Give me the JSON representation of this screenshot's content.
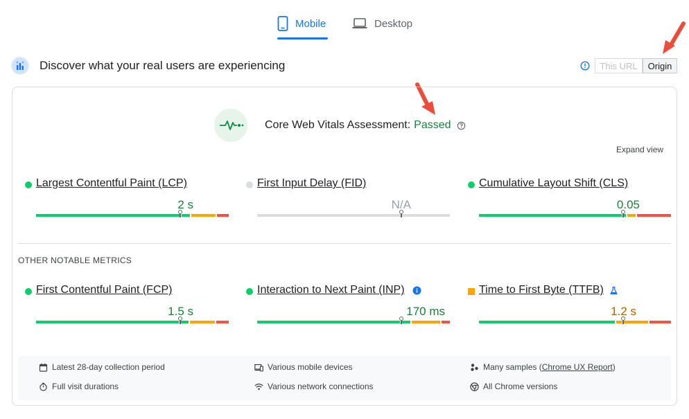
{
  "tabs": [
    {
      "label": "Mobile",
      "active": true
    },
    {
      "label": "Desktop",
      "active": false
    }
  ],
  "header": {
    "title": "Discover what your real users are experiencing",
    "scope_this_url": "This URL",
    "scope_origin": "Origin",
    "selected_scope": "Origin"
  },
  "assessment": {
    "label": "Core Web Vitals Assessment:",
    "status": "Passed",
    "expand_label": "Expand view"
  },
  "core_metrics": [
    {
      "name": "Largest Contentful Paint (LCP)",
      "value": "2 s",
      "status": "good",
      "marker": 0.75,
      "color": "#188038"
    },
    {
      "name": "First Input Delay (FID)",
      "value": "N/A",
      "status": "none",
      "marker": 0.75,
      "color": "#9aa0a6"
    },
    {
      "name": "Cumulative Layout Shift (CLS)",
      "value": "0.05",
      "status": "good",
      "marker": 0.75,
      "color": "#188038"
    }
  ],
  "other_title": "OTHER NOTABLE METRICS",
  "other_metrics": [
    {
      "name": "First Contentful Paint (FCP)",
      "value": "1.5 s",
      "status": "good",
      "marker": 0.75,
      "color": "#188038"
    },
    {
      "name": "Interaction to Next Paint (INP)",
      "value": "170 ms",
      "status": "good",
      "marker": 0.75,
      "color": "#188038"
    },
    {
      "name": "Time to First Byte (TTFB)",
      "value": "1.2 s",
      "status": "average",
      "marker": 0.75,
      "color": "#b06000"
    }
  ],
  "footer": {
    "collection_period": "Latest 28-day collection period",
    "devices": "Various mobile devices",
    "samples_prefix": "Many samples (",
    "samples_link": "Chrome UX Report",
    "samples_suffix": ")",
    "durations": "Full visit durations",
    "network": "Various network connections",
    "chrome_versions": "All Chrome versions"
  },
  "colors": {
    "accent": "#1a73e8",
    "good": "#0cce6b",
    "average": "#ffa400",
    "poor": "#ff4e42",
    "passed_text": "#188038",
    "arrow": "#ea4d3a"
  }
}
